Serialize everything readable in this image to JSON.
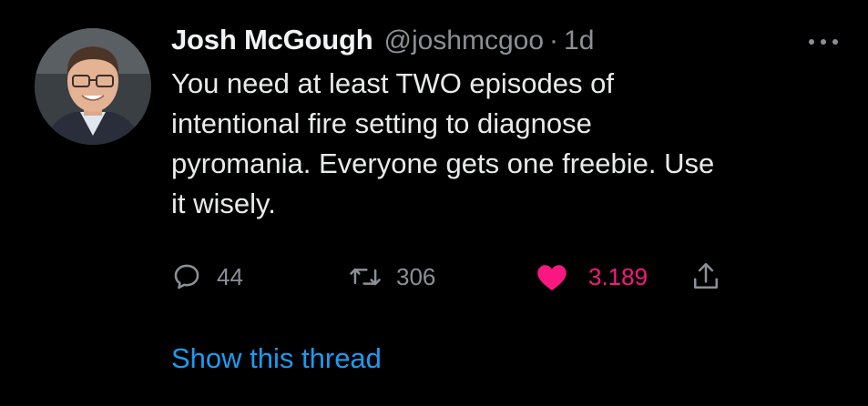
{
  "tweet": {
    "author": {
      "display_name": "Josh McGough",
      "handle": "@joshmcgoo",
      "separator": "·",
      "time": "1d"
    },
    "text_lines": [
      "You need at least TWO episodes of",
      "intentional fire setting to diagnose",
      "pyromania. Everyone gets one freebie. Use",
      "it wisely."
    ],
    "actions": {
      "reply": {
        "icon": "reply-icon",
        "count": "44"
      },
      "retweet": {
        "icon": "retweet-icon",
        "count": "306"
      },
      "like": {
        "icon": "heart-icon",
        "count": "3.189",
        "liked": true
      },
      "share": {
        "icon": "share-icon"
      }
    },
    "show_thread": "Show this thread",
    "more_icon": "more-icon"
  },
  "colors": {
    "background": "#000000",
    "text": "#e7e9ea",
    "secondary": "#8b9096",
    "link": "#1d9bf0",
    "like": "#f91880"
  }
}
